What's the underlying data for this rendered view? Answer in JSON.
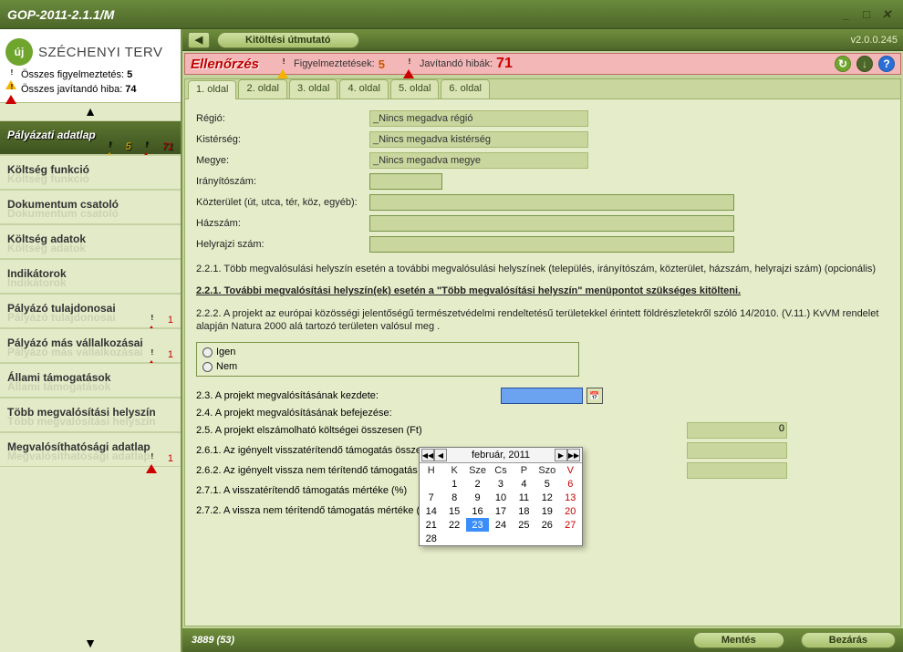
{
  "window": {
    "title": "GOP-2011-2.1.1/M"
  },
  "topbar": {
    "guide_label": "Kitöltési útmutató",
    "version": "v2.0.0.245"
  },
  "alert": {
    "title": "Ellenőrzés",
    "warn_label": "Figyelmeztetések:",
    "warn_count": "5",
    "err_label": "Javítandó hibák:",
    "err_count": "71"
  },
  "sidebar": {
    "logo_text": "SZÉCHENYI TERV",
    "total_warn_label": "Összes figyelmeztetés:",
    "total_warn_count": "5",
    "total_err_label": "Összes javítandó hiba:",
    "total_err_count": "74",
    "items": [
      {
        "label": "Pályázati adatlap",
        "warn": "5",
        "err": "71"
      },
      {
        "label": "Költség funkció",
        "warn": "",
        "err": ""
      },
      {
        "label": "Dokumentum csatoló",
        "warn": "",
        "err": ""
      },
      {
        "label": "Költség adatok",
        "warn": "",
        "err": ""
      },
      {
        "label": "Indikátorok",
        "warn": "",
        "err": ""
      },
      {
        "label": "Pályázó tulajdonosai",
        "warn": "",
        "err": "1"
      },
      {
        "label": "Pályázó más vállalkozásai",
        "warn": "",
        "err": "1"
      },
      {
        "label": "Állami támogatások",
        "warn": "",
        "err": ""
      },
      {
        "label": "Több megvalósítási helyszín",
        "warn": "",
        "err": ""
      },
      {
        "label": "Megvalósíthatósági adatlap",
        "warn": "",
        "err": "1"
      }
    ]
  },
  "tabs": [
    "1. oldal",
    "2. oldal",
    "3. oldal",
    "4. oldal",
    "5. oldal",
    "6. oldal"
  ],
  "form": {
    "regio_label": "Régió:",
    "regio_value": "_Nincs megadva régió",
    "kisterseg_label": "Kistérség:",
    "kisterseg_value": "_Nincs megadva kistérség",
    "megye_label": "Megye:",
    "megye_value": "_Nincs megadva megye",
    "irsz_label": "Irányítószám:",
    "kozterulet_label": "Közterület (út, utca, tér, köz, egyéb):",
    "hazszam_label": "Házszám:",
    "hrsz_label": "Helyrajzi szám:",
    "note221": "2.2.1. Több megvalósulási helyszín esetén a további megvalósulási helyszínek (település, irányítószám, közterület, házszám, helyrajzi szám) (opcionális)",
    "link221": "2.2.1. További megvalósítási helyszín(ek) esetén a \"Több megvalósítási helyszín\" menüpontot szükséges kitölteni.",
    "note222": "2.2.2. A projekt az európai közösségi jelentőségű természetvédelmi rendeltetésű területekkel érintett földrészletekről szóló 14/2010. (V.11.)  KvVM rendelet alapján Natura 2000 alá tartozó területen valósul meg .",
    "radio_igen": "Igen",
    "radio_nem": "Nem",
    "l23": "2.3. A projekt megvalósításának kezdete:",
    "l24": "2.4. A projekt megvalósításának befejezése:",
    "l25": "2.5. A projekt elszámolható költségei összesen (Ft)",
    "v25": "0",
    "l261": "2.6.1. Az igényelt visszatérítendő támogatás össze",
    "l262": "2.6.2. Az igényelt vissza nem térítendő támogatás",
    "l271": "2.7.1. A visszatérítendő támogatás mértéke (%)",
    "l272": "2.7.2. A vissza nem térítendő támogatás mértéke (%)"
  },
  "calendar": {
    "title": "február, 2011",
    "dow": [
      "H",
      "K",
      "Sze",
      "Cs",
      "P",
      "Szo",
      "V"
    ],
    "rows": [
      [
        "",
        "1",
        "2",
        "3",
        "4",
        "5",
        "6"
      ],
      [
        "7",
        "8",
        "9",
        "10",
        "11",
        "12",
        "13"
      ],
      [
        "14",
        "15",
        "16",
        "17",
        "18",
        "19",
        "20"
      ],
      [
        "21",
        "22",
        "23",
        "24",
        "25",
        "26",
        "27"
      ],
      [
        "28",
        "",
        "",
        "",
        "",
        "",
        ""
      ]
    ],
    "today": "23"
  },
  "footer": {
    "status": "3889 (53)",
    "save": "Mentés",
    "close": "Bezárás"
  }
}
